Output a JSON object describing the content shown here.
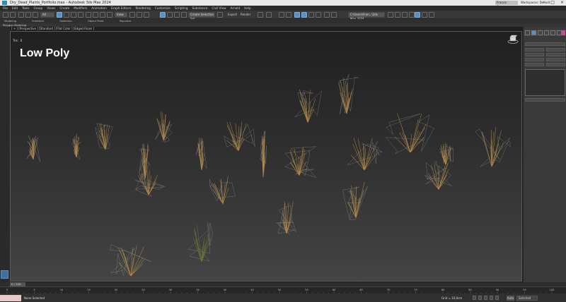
{
  "titlebar": {
    "title": "Dry_Dead_Plants_Portfolio.max - Autodesk 3ds Max 2024",
    "account": "Francis Coum...",
    "workspace": "Workspaces: Default"
  },
  "menu": [
    "File",
    "Edit",
    "Tools",
    "Group",
    "Views",
    "Create",
    "Modifiers",
    "Animation",
    "Graph Editors",
    "Rendering",
    "Customize",
    "Scripting",
    "Substance",
    "Civil View",
    "Arnold",
    "Help"
  ],
  "toolbar": {
    "filter": "All",
    "view": "View",
    "selection_set": "Create Selection Set",
    "export": "Export",
    "render": "Render",
    "project": "C:\\Users\\Fran...\\3ds Max 2024"
  },
  "ribbon": [
    "Modeling",
    "Freeform",
    "Selection",
    "Object Paint",
    "Populate"
  ],
  "polygon_modeling": "Polygon Modeling",
  "viewport": {
    "label": "[ + ] [Perspective ] [Standard ] [Flat Color ] [Edged Faces ]",
    "tris": "Tris:",
    "tris_value": "0",
    "heading": "Low Poly"
  },
  "timeline": {
    "slider": "0 / 100",
    "ticks": [
      "0",
      "5",
      "10",
      "15",
      "20",
      "25",
      "30",
      "35",
      "40",
      "45",
      "50",
      "55",
      "60",
      "65",
      "70",
      "75",
      "80",
      "85",
      "90",
      "95",
      "100"
    ]
  },
  "status": {
    "selected": "None Selected",
    "grid": "Grid = 10,0cm",
    "auto": "Auto",
    "selset": "Selected"
  },
  "colors": {
    "accent": "#5a8fc0",
    "plant": "#b08a4a",
    "wire": "#9a9a9a"
  }
}
